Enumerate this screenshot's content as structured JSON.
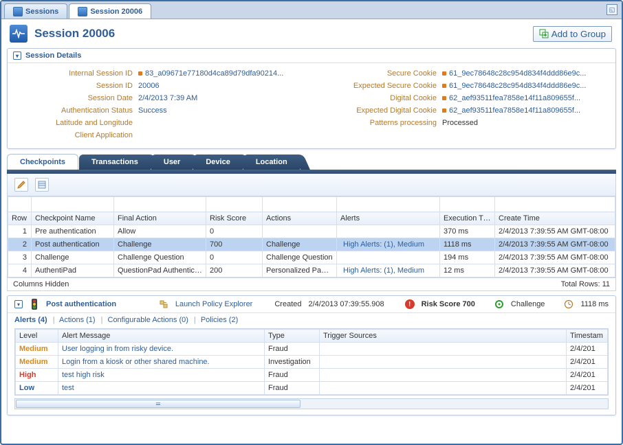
{
  "topTabs": {
    "sessions": "Sessions",
    "session": "Session 20006"
  },
  "pageTitle": "Session 20006",
  "addToGroup": "Add to Group",
  "detailsTitle": "Session Details",
  "left": [
    {
      "label": "Internal Session ID",
      "value": "83_a09671e77180d4ca89d79dfa90214...",
      "dot": true,
      "blue": true
    },
    {
      "label": "Session ID",
      "value": "20006",
      "blue": true
    },
    {
      "label": "Session Date",
      "value": "2/4/2013 7:39 AM",
      "blue": true
    },
    {
      "label": "Authentication Status",
      "value": "Success",
      "blue": true
    },
    {
      "label": "Latitude and Longitude",
      "value": ""
    },
    {
      "label": "Client Application",
      "value": ""
    }
  ],
  "right": [
    {
      "label": "Secure Cookie",
      "value": "61_9ec78648c28c954d834f4ddd86e9c...",
      "dot": true,
      "blue": true
    },
    {
      "label": "Expected Secure Cookie",
      "value": "61_9ec78648c28c954d834f4ddd86e9c...",
      "dot": true,
      "blue": true
    },
    {
      "label": "Digital Cookie",
      "value": "62_aef93511fea7858e14f11a809655f...",
      "dot": true,
      "blue": true
    },
    {
      "label": "Expected Digital Cookie",
      "value": "62_aef93511fea7858e14f11a809655f...",
      "dot": true,
      "blue": true
    },
    {
      "label": "Patterns processing",
      "value": "Processed"
    }
  ],
  "innerTabs": [
    "Checkpoints",
    "Transactions",
    "User",
    "Device",
    "Location"
  ],
  "gridCols": [
    "Row",
    "Checkpoint Name",
    "Final Action",
    "Risk Score",
    "Actions",
    "Alerts",
    "Execution Time",
    "Create Time"
  ],
  "gridRows": [
    {
      "n": 1,
      "name": "Pre authentication",
      "final": "Allow",
      "risk": "0",
      "actions": "",
      "alerts": "",
      "exec": "370 ms",
      "create": "2/4/2013 7:39:55 AM GMT-08:00"
    },
    {
      "n": 2,
      "name": "Post authentication",
      "final": "Challenge",
      "risk": "700",
      "actions": "Challenge",
      "alerts": "High Alerts: (1), Medium",
      "alertsDot": true,
      "exec": "1118 ms",
      "create": "2/4/2013 7:39:55 AM GMT-08:00",
      "sel": true
    },
    {
      "n": 3,
      "name": "Challenge",
      "final": "Challenge Question",
      "risk": "0",
      "actions": "Challenge Question",
      "alerts": "",
      "exec": "194 ms",
      "create": "2/4/2013 7:39:55 AM GMT-08:00"
    },
    {
      "n": 4,
      "name": "AuthentiPad",
      "final": "QuestionPad Authenticator",
      "risk": "200",
      "actions": "Personalized Pad, Qu",
      "alerts": "High Alerts: (1), Medium",
      "alertsDot": true,
      "exec": "12 ms",
      "create": "2/4/2013 7:39:55 AM GMT-08:00"
    }
  ],
  "gridFooterLeft": "Columns Hidden",
  "gridFooterRight": "Total Rows: 11",
  "bottomHead": {
    "title": "Post authentication",
    "policyLink": "Launch Policy Explorer",
    "createdLabel": "Created",
    "createdVal": "2/4/2013 07:39:55.908",
    "riskLabel": "Risk Score 700",
    "challenge": "Challenge",
    "time": "1118 ms"
  },
  "subLinks": {
    "alerts": "Alerts (4)",
    "actions": "Actions (1)",
    "conf": "Configurable Actions (0)",
    "policies": "Policies (2)"
  },
  "alertsCols": [
    "Level",
    "Alert Message",
    "Type",
    "Trigger Sources",
    "Timestam"
  ],
  "alerts": [
    {
      "level": "Medium",
      "msg": "User logging in from risky device.",
      "type": "Fraud",
      "trig": "",
      "ts": "2/4/201"
    },
    {
      "level": "Medium",
      "msg": "Login from a kiosk or other shared machine.",
      "type": "Investigation",
      "trig": "",
      "ts": "2/4/201"
    },
    {
      "level": "High",
      "msg": "test high risk",
      "type": "Fraud",
      "trig": "",
      "ts": "2/4/201"
    },
    {
      "level": "Low",
      "msg": "test",
      "type": "Fraud",
      "trig": "",
      "ts": "2/4/201"
    }
  ]
}
